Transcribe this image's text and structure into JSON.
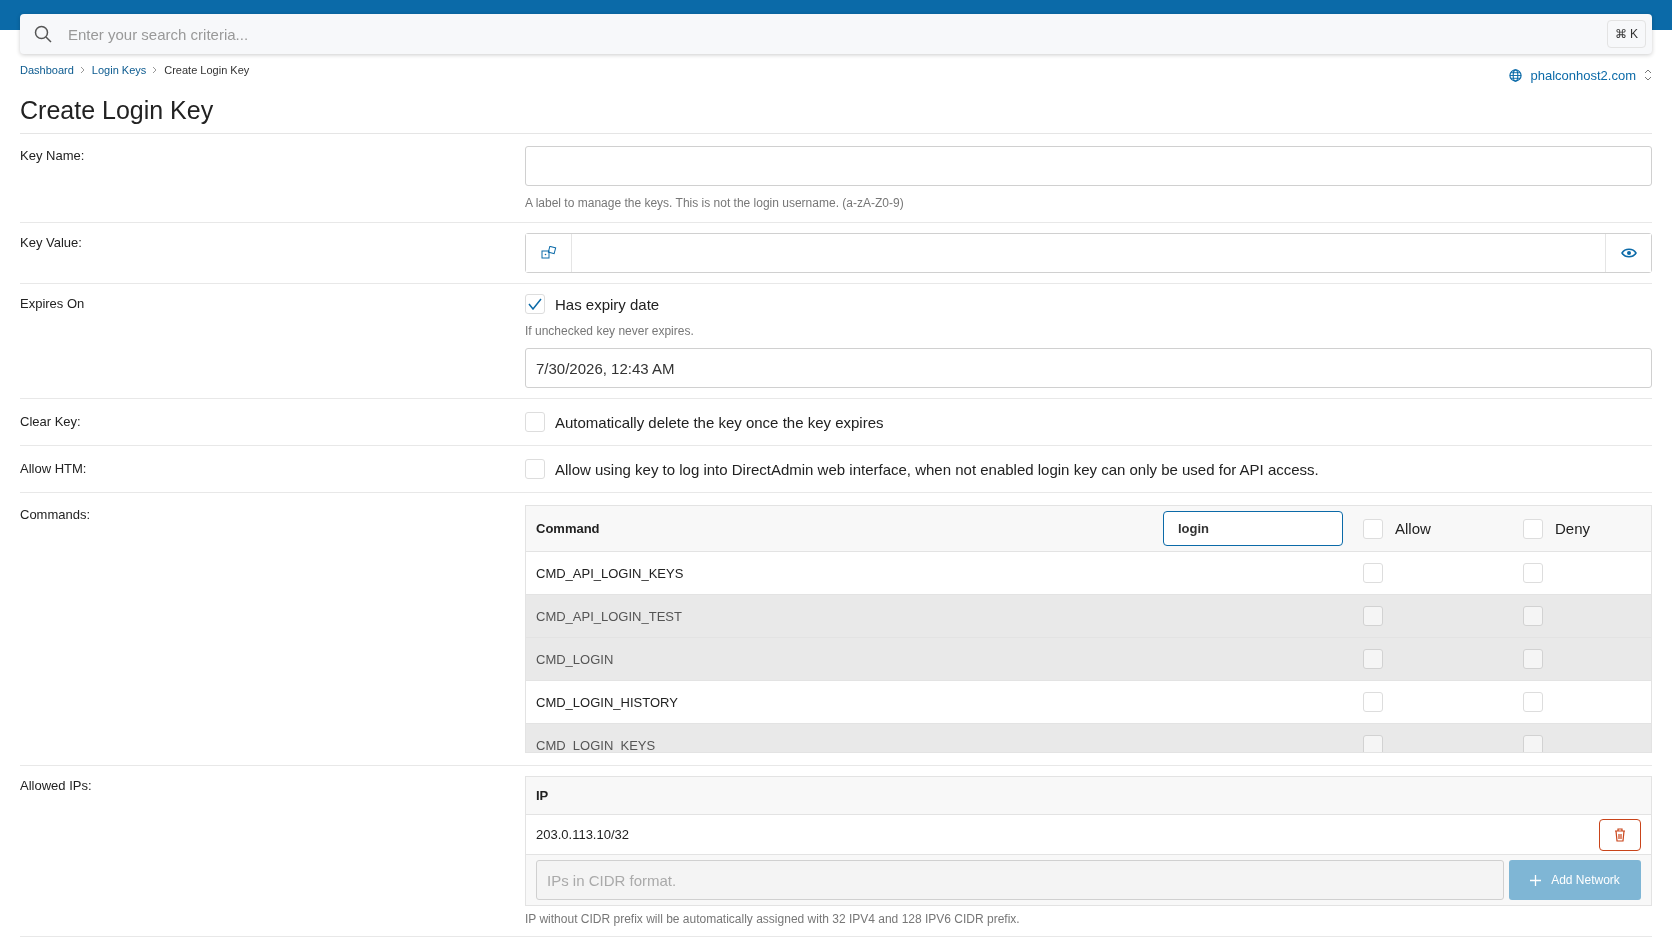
{
  "search": {
    "placeholder": "Enter your search criteria...",
    "shortcut": "⌘ K"
  },
  "breadcrumb": [
    {
      "label": "Dashboard",
      "link": true
    },
    {
      "label": "Login Keys",
      "link": true
    },
    {
      "label": "Create Login Key",
      "link": false
    }
  ],
  "domain": "phalconhost2.com",
  "title": "Create Login Key",
  "key_name": {
    "label": "Key Name:",
    "hint": "A label to manage the keys. This is not the login username. (a-zA-Z0-9)"
  },
  "key_value": {
    "label": "Key Value:"
  },
  "expires": {
    "label": "Expires On",
    "checkbox": "Has expiry date",
    "checked": true,
    "hint": "If unchecked key never expires.",
    "value": "7/30/2026, 12:43 AM"
  },
  "clear_key": {
    "label": "Clear Key:",
    "checkbox": "Automatically delete the key once the key expires",
    "checked": false
  },
  "allow_htm": {
    "label": "Allow HTM:",
    "checkbox": "Allow using key to log into DirectAdmin web interface, when not enabled login key can only be used for API access.",
    "checked": false
  },
  "commands": {
    "label": "Commands:",
    "column": "Command",
    "filter": "login",
    "allow": {
      "label": "Allow",
      "checked": false
    },
    "deny": {
      "label": "Deny",
      "checked": false
    },
    "rows": [
      {
        "name": "CMD_API_LOGIN_KEYS",
        "disabled": false,
        "allow": false,
        "deny": false
      },
      {
        "name": "CMD_API_LOGIN_TEST",
        "disabled": true,
        "allow": false,
        "deny": false
      },
      {
        "name": "CMD_LOGIN",
        "disabled": true,
        "allow": false,
        "deny": false
      },
      {
        "name": "CMD_LOGIN_HISTORY",
        "disabled": false,
        "allow": false,
        "deny": false
      },
      {
        "name": "CMD_LOGIN_KEYS",
        "disabled": true,
        "allow": false,
        "deny": false
      }
    ]
  },
  "allowed_ips": {
    "label": "Allowed IPs:",
    "column": "IP",
    "rows": [
      "203.0.113.10/32"
    ],
    "placeholder": "IPs in CIDR format.",
    "button": "Add Network",
    "hint": "IP without CIDR prefix will be automatically assigned with 32 IPV4 and 128 IPV6 CIDR prefix."
  }
}
